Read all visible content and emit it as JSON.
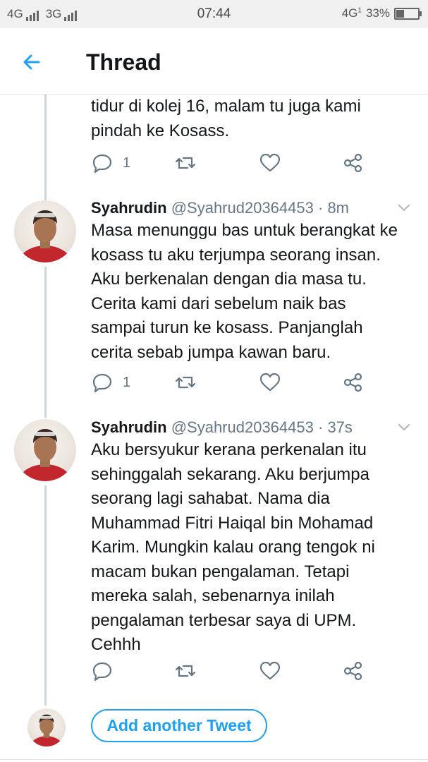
{
  "status_bar": {
    "network_left": "4G",
    "network_mid": "3G",
    "time": "07:44",
    "network_right": "4G",
    "sim_indicator": "1",
    "battery_percent": "33%",
    "battery_level": 0.33
  },
  "header": {
    "title": "Thread",
    "back_icon": "arrow-left-icon"
  },
  "colors": {
    "accent": "#1da1f2",
    "text": "#14171a",
    "secondary": "#657786",
    "thread_line": "#ccd6dd"
  },
  "tweets": [
    {
      "text": "tidur di kolej 16, malam tu juga kami\npindah ke Kosass.",
      "reply_count": "1"
    },
    {
      "name": "Syahrudin",
      "handle": "@Syahrud20364453",
      "time": "· 8m",
      "text": "Masa menunggu bas untuk berangkat ke\nkosass tu aku terjumpa seorang insan.\nAku berkenalan dengan dia masa tu.\nCerita kami dari sebelum naik bas\nsampai turun ke kosass. Panjanglah\ncerita sebab jumpa kawan baru.",
      "reply_count": "1"
    },
    {
      "name": "Syahrudin",
      "handle": "@Syahrud20364453",
      "time": "· 37s",
      "text": "Aku bersyukur kerana perkenalan itu\nsehinggalah sekarang. Aku berjumpa\nseorang lagi sahabat. Nama dia\nMuhammad Fitri Haiqal bin Mohamad\nKarim. Mungkin kalau orang tengok ni\nmacam bukan pengalaman. Tetapi\nmereka salah, sebenarnya inilah\npengalaman terbesar saya di UPM.\nCehhh",
      "reply_count": ""
    }
  ],
  "composer": {
    "add_button_label": "Add another Tweet"
  }
}
